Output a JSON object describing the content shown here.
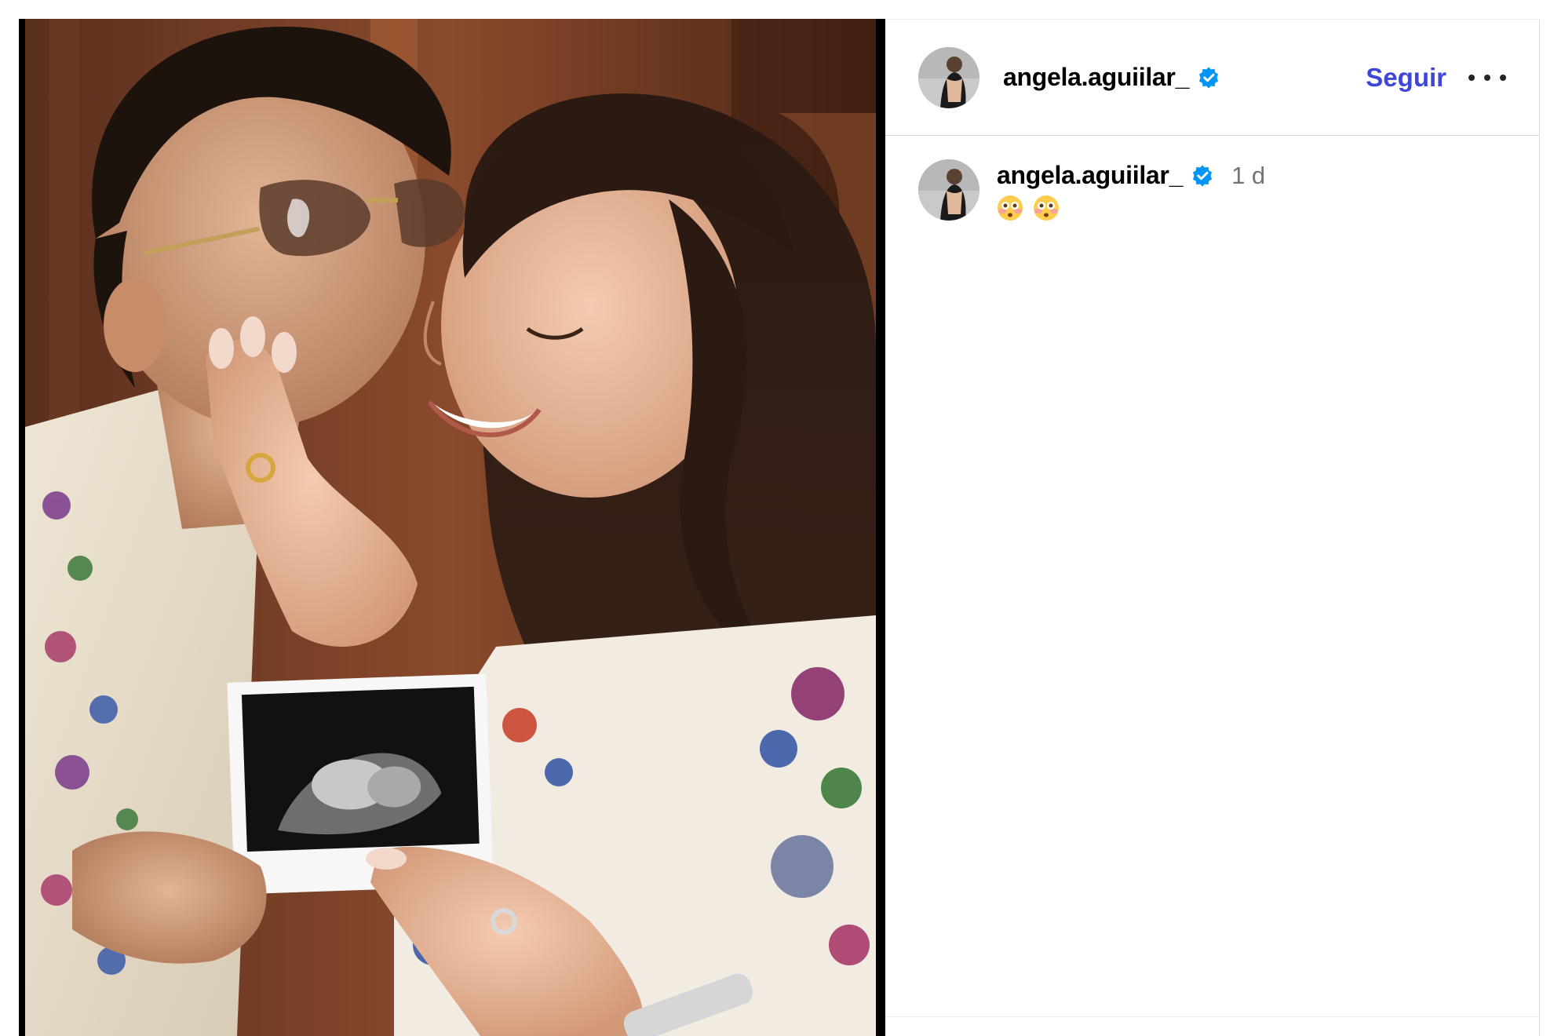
{
  "post": {
    "username": "angela.aguiilar_",
    "follow_label": "Seguir",
    "more_icon": "more-horizontal-icon"
  },
  "comment": {
    "username": "angela.aguiilar_",
    "time": "1 d",
    "emojis": [
      "😳",
      "😳"
    ]
  },
  "colors": {
    "follow": "#3e46d6",
    "verified": "#0095f6",
    "muted_text": "#737373"
  }
}
